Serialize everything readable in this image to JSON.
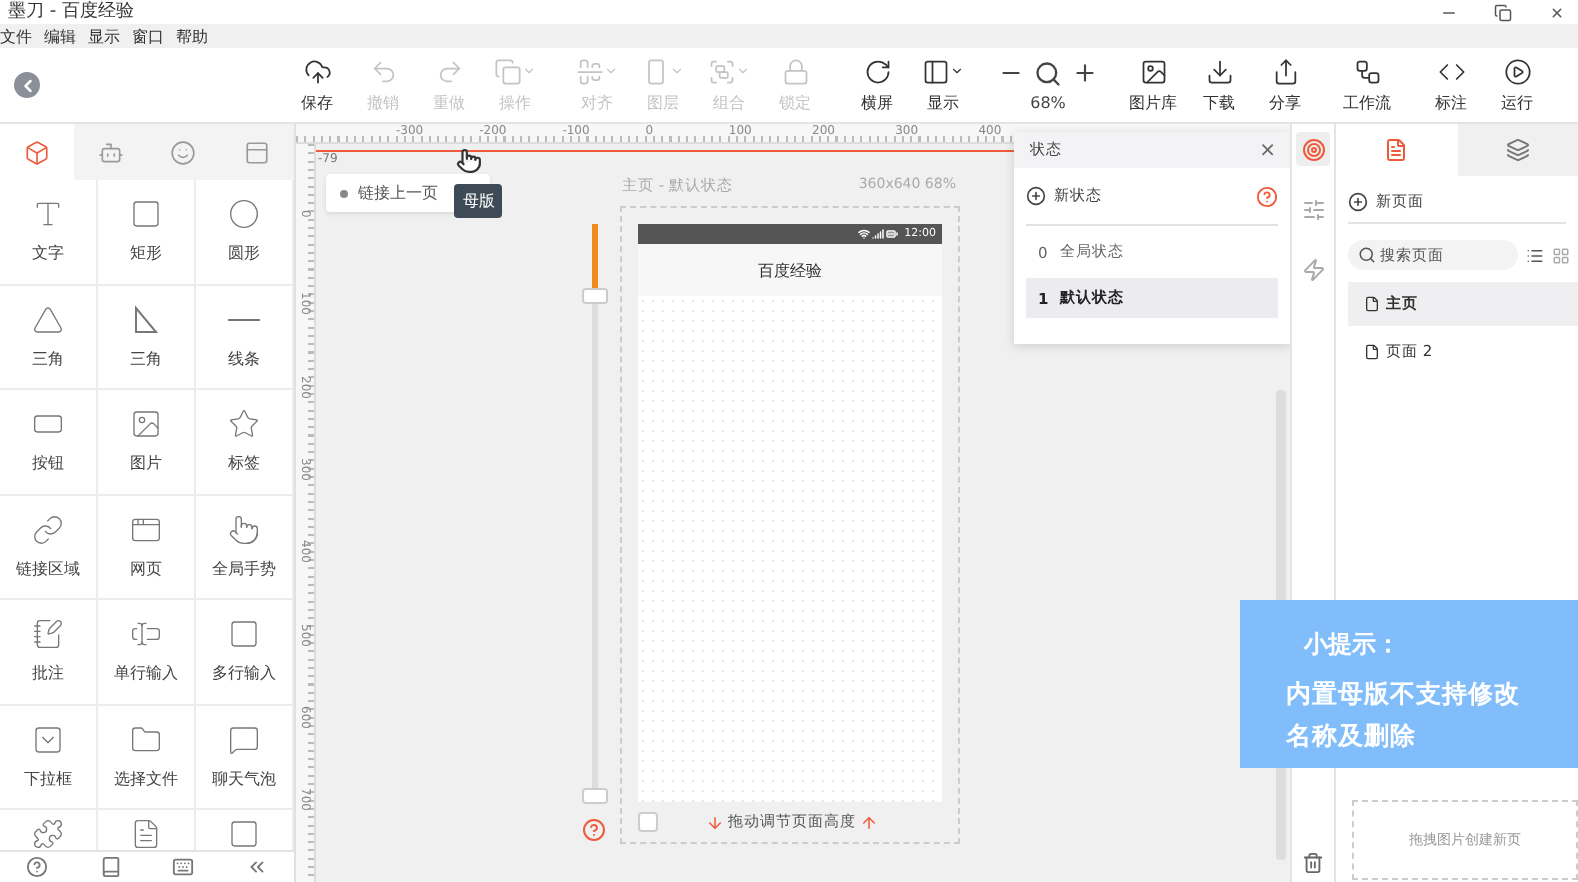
{
  "window": {
    "title": "墨刀 - 百度经验"
  },
  "menu": [
    "文件",
    "编辑",
    "显示",
    "窗口",
    "帮助"
  ],
  "toolbar": {
    "groups": [
      [
        {
          "kind": "button",
          "label": "保存",
          "disabled": false,
          "dropdown": false
        },
        {
          "kind": "button",
          "label": "撤销",
          "disabled": true,
          "dropdown": false
        },
        {
          "kind": "button",
          "label": "重做",
          "disabled": true,
          "dropdown": false
        },
        {
          "kind": "button",
          "label": "操作",
          "disabled": true,
          "dropdown": true
        }
      ],
      [
        {
          "kind": "button",
          "label": "对齐",
          "disabled": true,
          "dropdown": true
        },
        {
          "kind": "button",
          "label": "图层",
          "disabled": true,
          "dropdown": true
        },
        {
          "kind": "button",
          "label": "组合",
          "disabled": true,
          "dropdown": true
        },
        {
          "kind": "button",
          "label": "锁定",
          "disabled": true,
          "dropdown": false
        }
      ],
      [
        {
          "kind": "button",
          "label": "横屏",
          "disabled": false,
          "dropdown": false
        },
        {
          "kind": "button",
          "label": "显示",
          "disabled": false,
          "dropdown": true
        }
      ],
      [
        {
          "kind": "zoom",
          "label": "68%"
        }
      ],
      [
        {
          "kind": "button",
          "label": "图片库",
          "disabled": false,
          "dropdown": false
        },
        {
          "kind": "button",
          "label": "下载",
          "disabled": false,
          "dropdown": false
        },
        {
          "kind": "button",
          "label": "分享",
          "disabled": false,
          "dropdown": false
        }
      ],
      [
        {
          "kind": "button",
          "label": "工作流",
          "disabled": false,
          "dropdown": false
        }
      ],
      [
        {
          "kind": "button",
          "label": "标注",
          "disabled": false,
          "dropdown": false
        },
        {
          "kind": "button",
          "label": "运行",
          "disabled": false,
          "dropdown": false
        }
      ]
    ]
  },
  "left_tabs": [
    {
      "selected": true
    },
    {
      "selected": false
    },
    {
      "selected": false
    },
    {
      "selected": false,
      "tooltip": "母版"
    }
  ],
  "components": [
    {
      "kind": "tool",
      "label": "文字"
    },
    {
      "kind": "tool",
      "label": "矩形"
    },
    {
      "kind": "tool",
      "label": "圆形"
    },
    {
      "kind": "tool",
      "label": "三角"
    },
    {
      "kind": "tool",
      "label": "三角"
    },
    {
      "kind": "tool",
      "label": "线条"
    },
    {
      "kind": "tool",
      "label": "按钮"
    },
    {
      "kind": "tool",
      "label": "图片"
    },
    {
      "kind": "tool",
      "label": "标签"
    },
    {
      "kind": "tool",
      "label": "链接区域"
    },
    {
      "kind": "tool",
      "label": "网页"
    },
    {
      "kind": "tool",
      "label": "全局手势"
    },
    {
      "kind": "tool",
      "label": "批注"
    },
    {
      "kind": "tool",
      "label": "单行输入"
    },
    {
      "kind": "tool",
      "label": "多行输入"
    },
    {
      "kind": "tool",
      "label": "下拉框"
    },
    {
      "kind": "tool",
      "label": "选择文件"
    },
    {
      "kind": "tool",
      "label": "聊天气泡"
    },
    {
      "kind": "cut"
    },
    {
      "kind": "cut"
    },
    {
      "kind": "cut"
    }
  ],
  "canvas": {
    "corner": "-79",
    "h_ruler": [
      "-300",
      "-200",
      "-100",
      "0",
      "100",
      "200",
      "300",
      "400"
    ],
    "v_ruler": [
      "0",
      "100",
      "200",
      "300",
      "400",
      "500",
      "600",
      "700"
    ],
    "back_link": "链接上一页",
    "page_title": "主页 - 默认状态",
    "page_size": "360x640 68%",
    "phone": {
      "time": "12:00",
      "header": "百度经验",
      "checked": false,
      "resize_hint": "拖动调节页面高度"
    },
    "height_slider": {
      "level": 0.12
    }
  },
  "states_panel": {
    "title": "状态",
    "close": "×",
    "new_state": "新状态",
    "states": [
      {
        "index": "0",
        "name": "全局状态",
        "selected": false
      },
      {
        "index": "1",
        "name": "默认状态",
        "selected": true
      }
    ]
  },
  "right_strip": [
    {
      "selected": true
    },
    {
      "selected": false
    },
    {
      "selected": false
    }
  ],
  "right_panel": {
    "tabs": [
      {
        "selected": true
      },
      {
        "selected": false
      }
    ],
    "new_page": "新页面",
    "search": {
      "placeholder": "搜索页面"
    },
    "pages": [
      {
        "name": "主页",
        "selected": true
      },
      {
        "name": "页面 2",
        "selected": false
      }
    ],
    "drop_zone": "拖拽图片创建新页"
  },
  "tip": {
    "title": "小提示：",
    "text": "内置母版不支持修改名称及删除"
  }
}
